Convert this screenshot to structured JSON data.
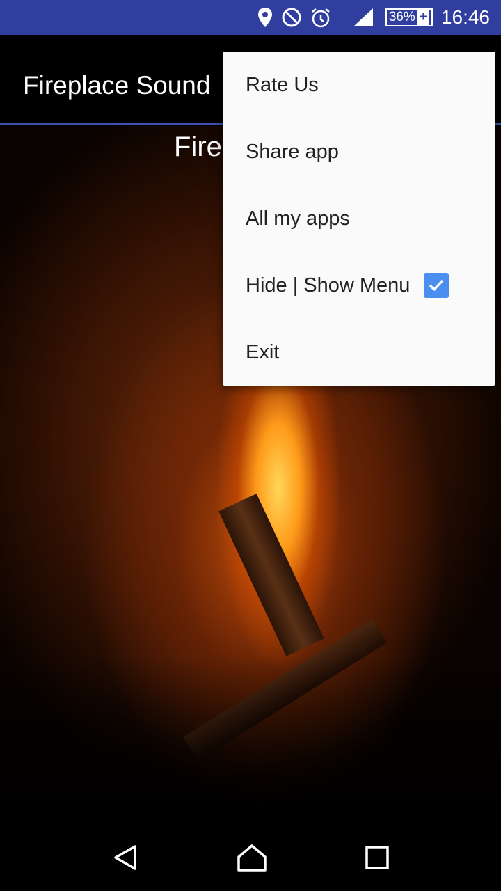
{
  "status_bar": {
    "time": "16:46",
    "battery": "36%",
    "icons": [
      "location-icon",
      "do-not-disturb-icon",
      "alarm-icon",
      "signal-icon",
      "battery-charging-icon"
    ],
    "color": "#303f9f"
  },
  "app_bar": {
    "title": "Fireplace Sound"
  },
  "content": {
    "subtitle": "Fire"
  },
  "menu": {
    "items": [
      {
        "label": "Rate Us"
      },
      {
        "label": "Share app"
      },
      {
        "label": "All my apps"
      },
      {
        "label": "Hide | Show Menu",
        "checked": true
      },
      {
        "label": "Exit"
      }
    ]
  },
  "nav_bar": {
    "buttons": [
      "back",
      "home",
      "recents"
    ]
  }
}
